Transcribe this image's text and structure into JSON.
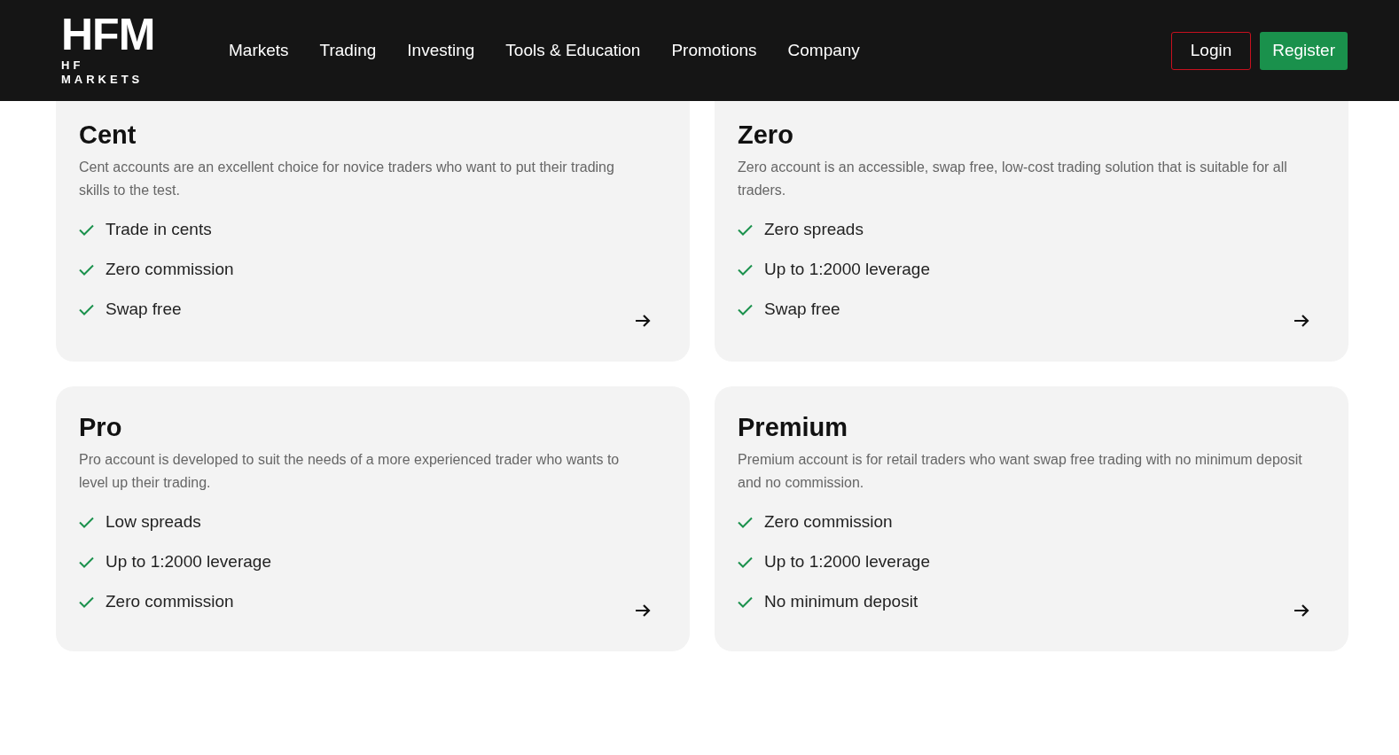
{
  "logo": {
    "mark": "HFM",
    "name": "HF MARKETS"
  },
  "nav": [
    "Markets",
    "Trading",
    "Investing",
    "Tools & Education",
    "Promotions",
    "Company"
  ],
  "actions": [
    {
      "label": "Login",
      "kind": "outline"
    },
    {
      "label": "Register",
      "kind": "filled"
    }
  ],
  "accounts": [
    {
      "title": "Cent",
      "description": "Cent accounts are an excellent choice for novice traders who want to put their trading skills to the test.",
      "features": [
        "Trade in cents",
        "Zero commission",
        "Swap free"
      ]
    },
    {
      "title": "Zero",
      "description": "Zero account is an accessible, swap free, low-cost trading solution that is suitable for all traders.",
      "features": [
        "Zero spreads",
        "Up to 1:2000 leverage",
        "Swap free"
      ]
    },
    {
      "title": "Pro",
      "description": "Pro account is developed to suit the needs of a more experienced trader who wants to level up their trading.",
      "features": [
        "Low spreads",
        "Up to 1:2000 leverage",
        "Zero commission"
      ]
    },
    {
      "title": "Premium",
      "description": "Premium account is for retail traders who want swap free trading with no minimum deposit and no commission.",
      "features": [
        "Zero commission",
        "Up to 1:2000 leverage",
        "No minimum deposit"
      ]
    }
  ]
}
